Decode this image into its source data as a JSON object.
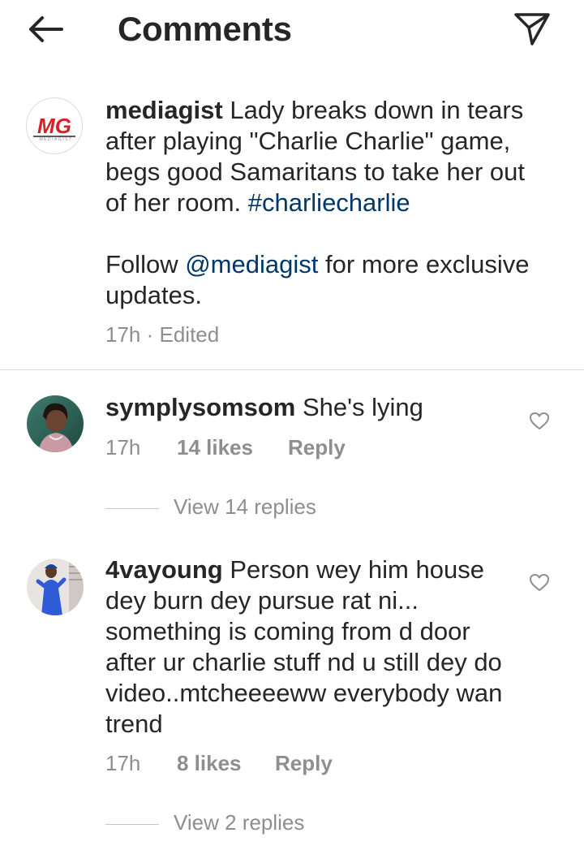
{
  "header": {
    "title": "Comments",
    "back_icon": "arrow-left-icon",
    "share_icon": "paper-plane-icon"
  },
  "caption": {
    "avatar_text": "MG",
    "avatar_subtext": "MEDIAGIST",
    "username": "mediagist",
    "text_part1": " Lady breaks down in tears after playing \"Charlie Charlie\" game, begs good Samaritans to take her out of her room. ",
    "hashtag": "#charliecharlie",
    "follow_prefix": "Follow ",
    "mention": "@mediagist",
    "follow_suffix": " for more exclusive updates.",
    "time": "17h",
    "edited": "· Edited"
  },
  "comments": [
    {
      "username": "symplysomsom",
      "text": " She's lying",
      "time": "17h",
      "likes": "14 likes",
      "reply": "Reply",
      "view_replies": "View 14 replies"
    },
    {
      "username": "4vayoung",
      "text": " Person wey him house dey burn dey pursue rat ni... something is coming from d door after ur charlie stuff nd u still dey do video..mtcheeeeww everybody wan trend",
      "time": "17h",
      "likes": "8 likes",
      "reply": "Reply",
      "view_replies": "View 2 replies"
    }
  ],
  "colors": {
    "link": "#00376b",
    "meta": "#8e8e8e",
    "text": "#262626",
    "brand_red": "#d62027"
  }
}
